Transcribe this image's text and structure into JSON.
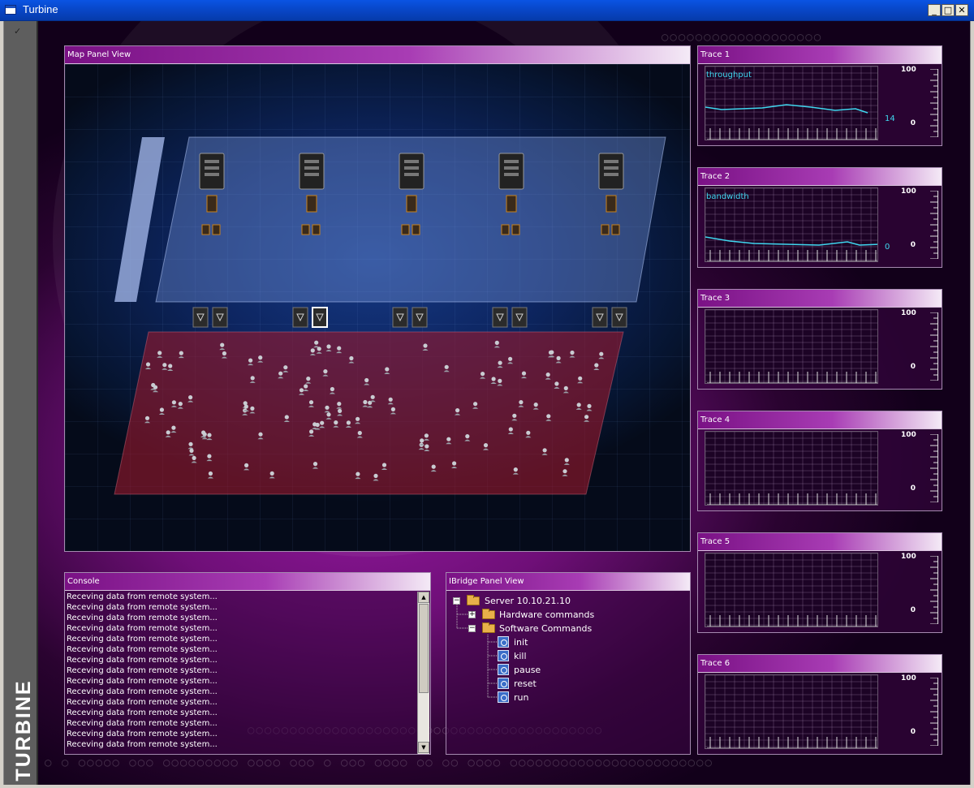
{
  "window": {
    "title": "Turbine",
    "min": "_",
    "max": "□",
    "close": "✕"
  },
  "brand": "TURBINE",
  "map": {
    "title": "Map Panel View",
    "servers": 5
  },
  "console": {
    "title": "Console",
    "lines": [
      "Receving data from remote system...",
      "Receving data from remote system...",
      "Receving data from remote system...",
      "Receving data from remote system...",
      "Receving data from remote system...",
      "Receving data from remote system...",
      "Receving data from remote system...",
      "Receving data from remote system...",
      "Receving data from remote system...",
      "Receving data from remote system...",
      "Receving data from remote system...",
      "Receving data from remote system...",
      "Receving data from remote system...",
      "Receving data from remote system...",
      "Receving data from remote system..."
    ],
    "scroll_up": "▲",
    "scroll_down": "▼"
  },
  "ibridge": {
    "title": "IBridge Panel View",
    "server": "Server 10.10.21.10",
    "hardware": "Hardware commands",
    "software": "Software Commands",
    "commands": [
      "init",
      "kill",
      "pause",
      "reset",
      "run"
    ],
    "expand_collapsed": "+",
    "expand_open": "−"
  },
  "traces": [
    {
      "title": "Trace 1",
      "label": "throughput",
      "max": "100",
      "min": "0",
      "current": "14"
    },
    {
      "title": "Trace 2",
      "label": "bandwidth",
      "max": "100",
      "min": "0",
      "current": "0"
    },
    {
      "title": "Trace 3",
      "label": "",
      "max": "100",
      "min": "0",
      "current": ""
    },
    {
      "title": "Trace 4",
      "label": "",
      "max": "100",
      "min": "0",
      "current": ""
    },
    {
      "title": "Trace 5",
      "label": "",
      "max": "100",
      "min": "0",
      "current": ""
    },
    {
      "title": "Trace 6",
      "label": "",
      "max": "100",
      "min": "0",
      "current": ""
    }
  ],
  "colors": {
    "accent": "#a83cb4",
    "trace_line": "#3fd7ef",
    "server_plane": "#5a7fd0",
    "client_plane": "#8a1a2a"
  }
}
